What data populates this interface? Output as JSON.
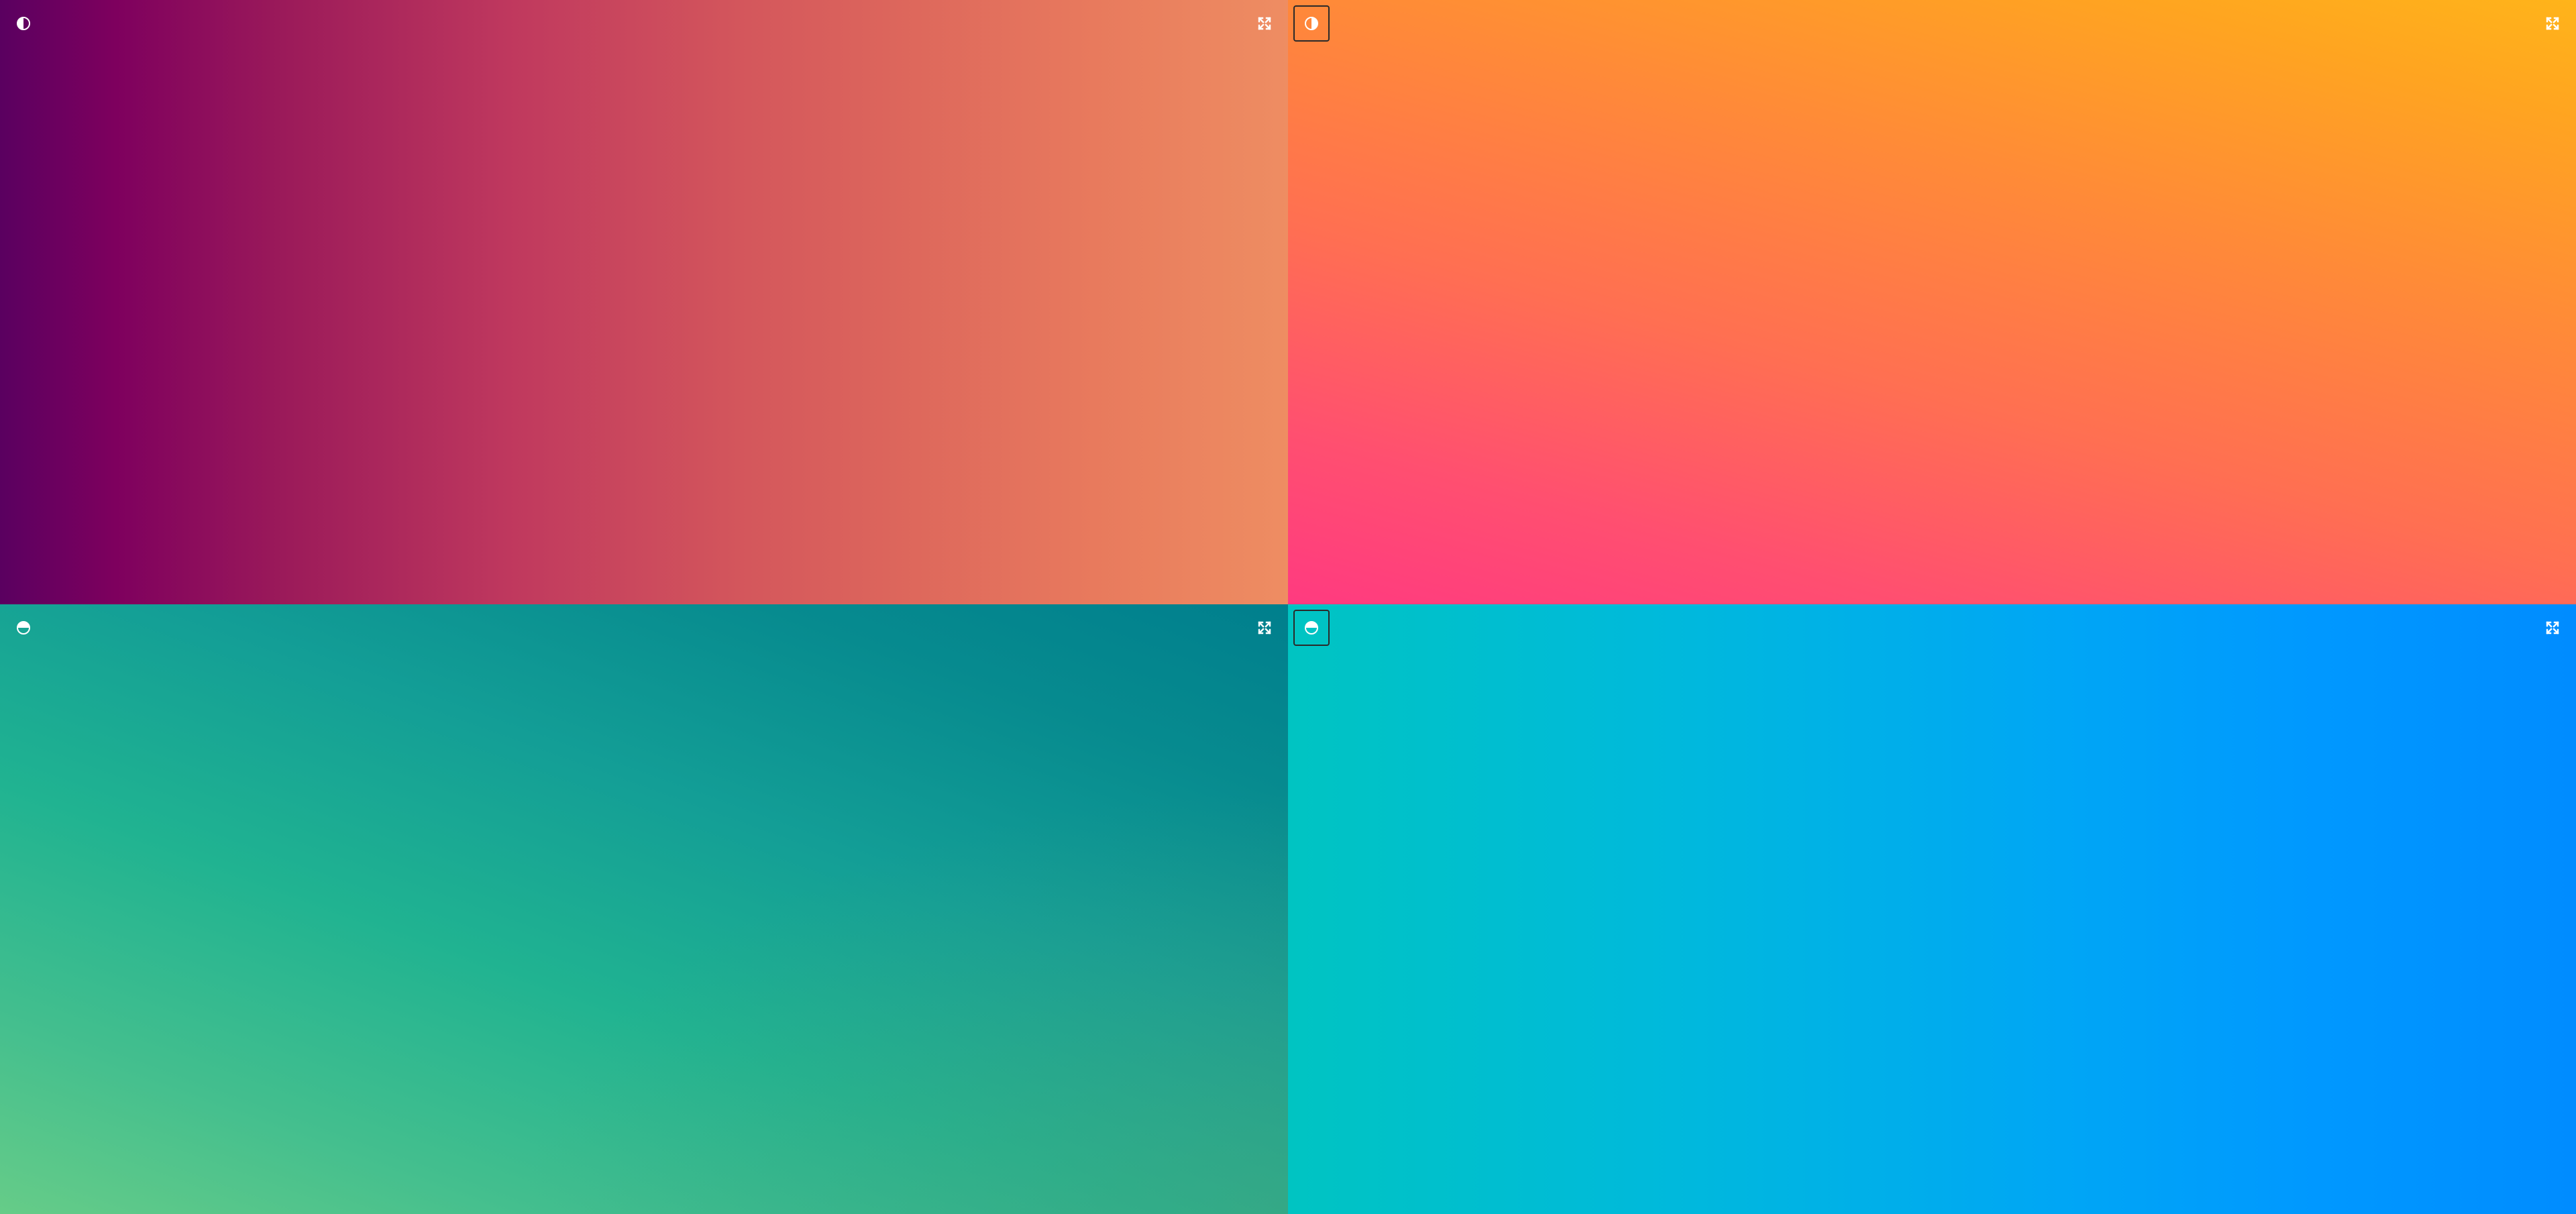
{
  "panels": [
    {
      "id": "top-left",
      "theme_icon": "half-circle-left-icon",
      "theme_button_boxed": false,
      "expand_icon": "expand-icon",
      "gradient_colors": [
        "#5a0060",
        "#7e005e",
        "#c0395e",
        "#e87a5d",
        "#ee8d62"
      ]
    },
    {
      "id": "top-right",
      "theme_icon": "half-circle-right-icon",
      "theme_button_boxed": true,
      "expand_icon": "expand-icon",
      "gradient_colors": [
        "#ff3a80",
        "#ff6f52",
        "#ff8a38",
        "#ffb41a"
      ]
    },
    {
      "id": "bottom-left",
      "theme_icon": "half-circle-top-icon",
      "theme_button_boxed": false,
      "expand_icon": "expand-icon",
      "gradient_colors": [
        "#66cc88",
        "#20b391",
        "#078b8f",
        "#007f8d"
      ]
    },
    {
      "id": "bottom-right",
      "theme_icon": "half-circle-top-icon",
      "theme_button_boxed": true,
      "expand_icon": "expand-icon",
      "gradient_colors": [
        "#00c4c2",
        "#00b9dc",
        "#00a6f5",
        "#008cff"
      ]
    }
  ]
}
